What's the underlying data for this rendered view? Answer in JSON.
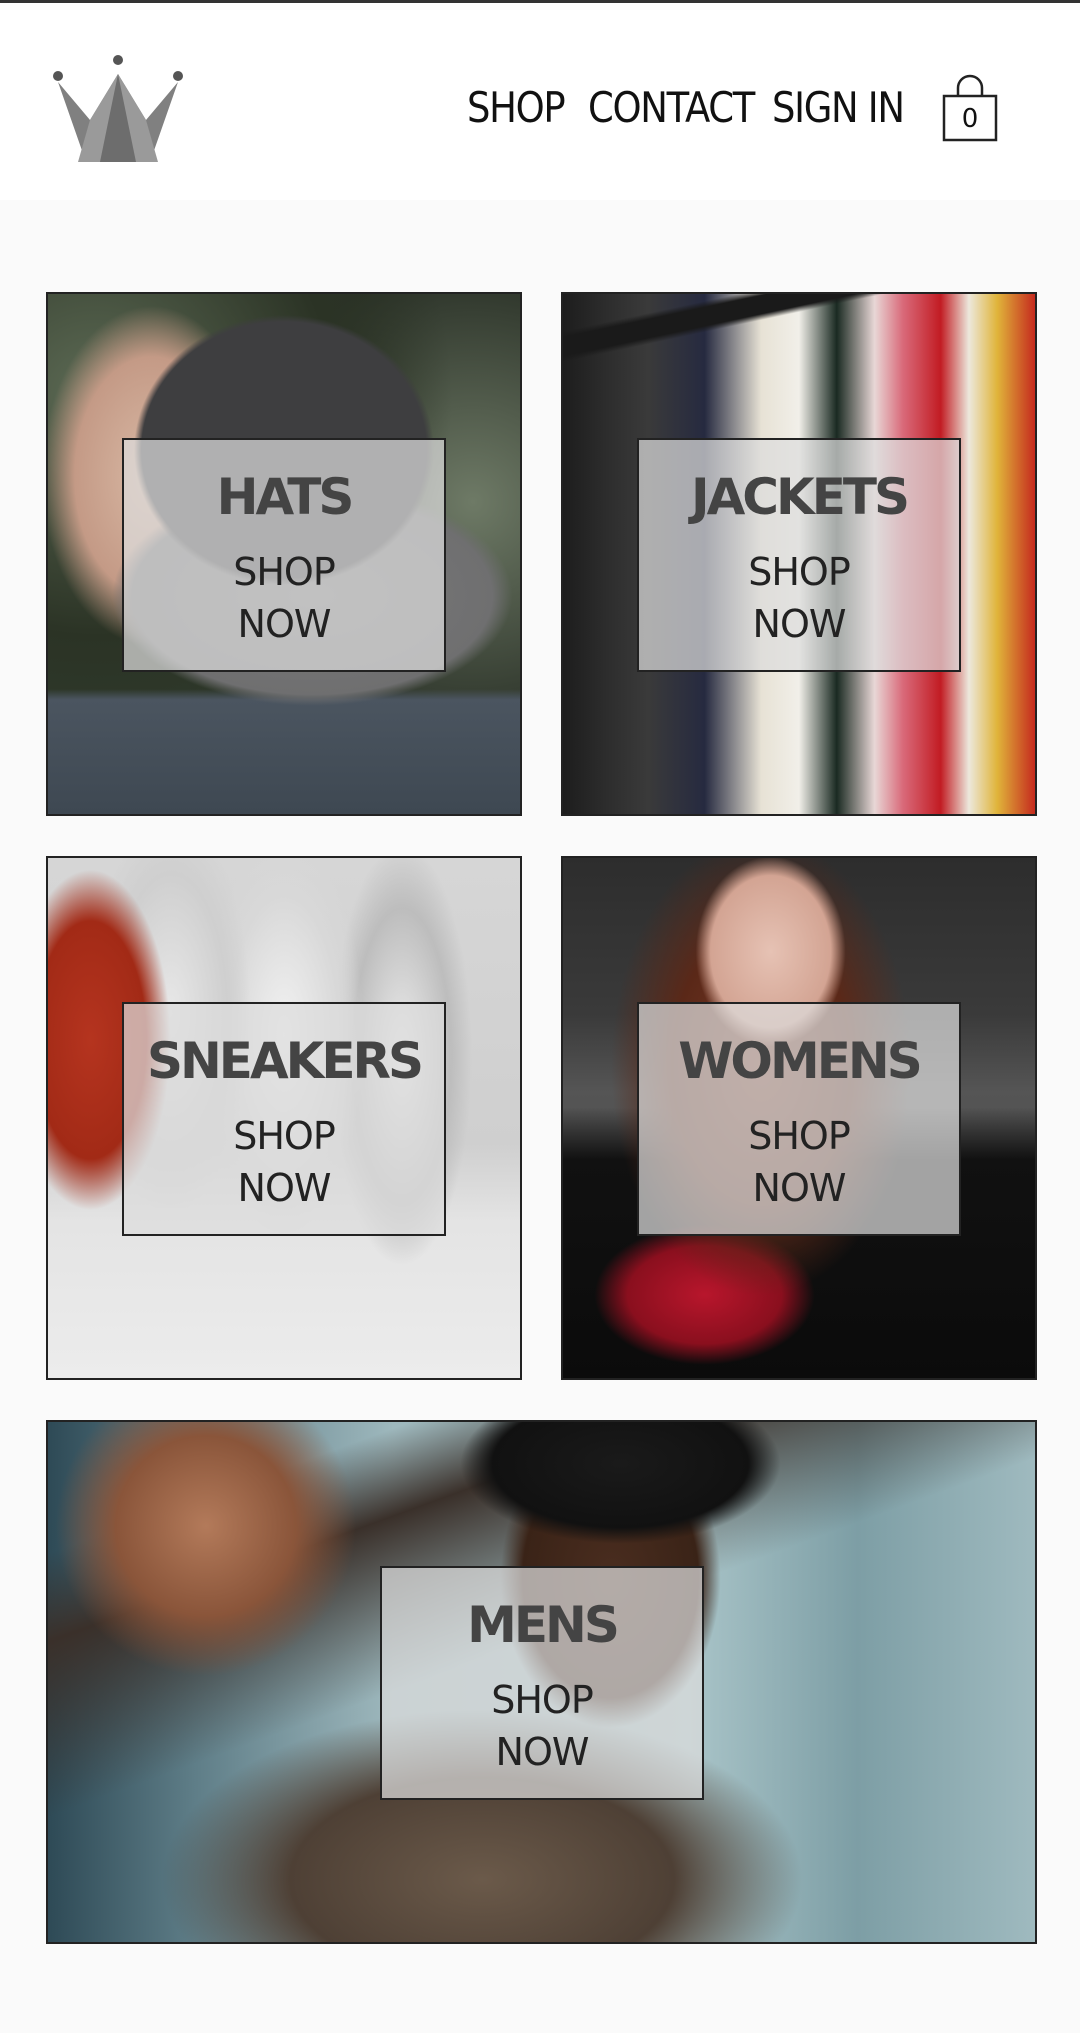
{
  "header": {
    "logo": "crown-logo",
    "nav": [
      {
        "label": "SHOP"
      },
      {
        "label": "CONTACT"
      },
      {
        "label": "SIGN IN"
      }
    ],
    "cart": {
      "icon": "shopping-bag-icon",
      "count": "0"
    }
  },
  "categories": [
    {
      "title": "HATS",
      "cta_line1": "SHOP",
      "cta_line2": "NOW"
    },
    {
      "title": "JACKETS",
      "cta_line1": "SHOP",
      "cta_line2": "NOW"
    },
    {
      "title": "SNEAKERS",
      "cta_line1": "SHOP",
      "cta_line2": "NOW"
    },
    {
      "title": "WOMENS",
      "cta_line1": "SHOP",
      "cta_line2": "NOW"
    },
    {
      "title": "MENS",
      "cta_line1": "SHOP",
      "cta_line2": "NOW"
    }
  ]
}
